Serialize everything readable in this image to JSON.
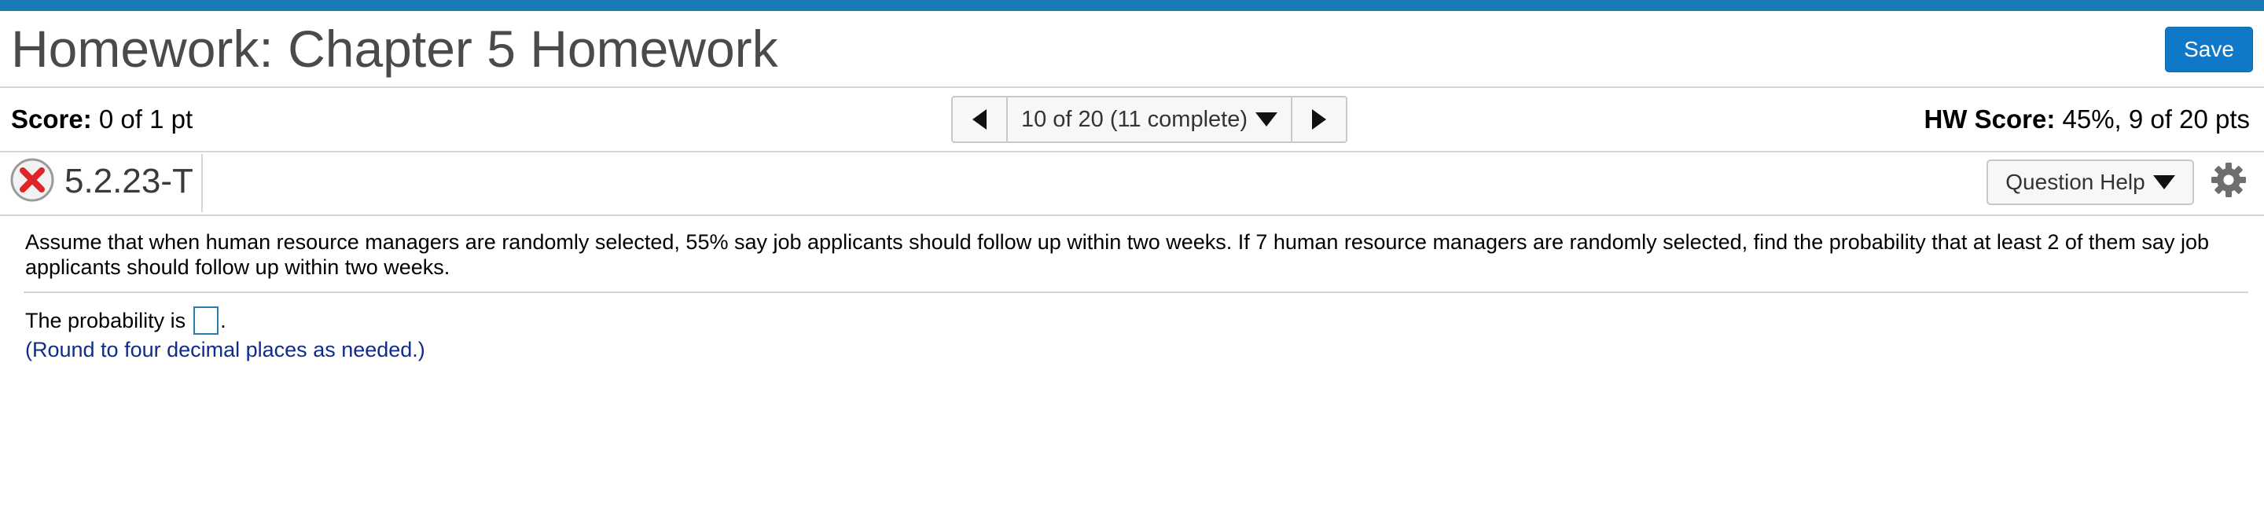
{
  "header": {
    "title": "Homework: Chapter 5 Homework",
    "save_label": "Save",
    "accent_color": "#1a7ab8"
  },
  "score_bar": {
    "score_label": "Score:",
    "score_value": "0 of 1 pt",
    "hw_score_label": "HW Score:",
    "hw_score_value": "45%, 9 of 20 pts",
    "nav": {
      "position_text": "10 of 20 (11 complete)",
      "prev_icon": "triangle-left-icon",
      "next_icon": "triangle-right-icon",
      "dropdown_icon": "triangle-down-icon"
    }
  },
  "question_header": {
    "status_icon": "incorrect-x-icon",
    "question_id": "5.2.23-T",
    "help_label": "Question Help",
    "settings_icon": "gear-icon"
  },
  "question": {
    "text": "Assume that when human resource managers are randomly selected, 55% say job applicants should follow up within two weeks. If 7 human resource managers are randomly selected, find the probability that at least 2 of them say job applicants should follow up within two weeks.",
    "answer_prefix": "The probability is",
    "answer_value": "",
    "answer_suffix": ".",
    "hint": "(Round to four decimal places as needed.)"
  }
}
